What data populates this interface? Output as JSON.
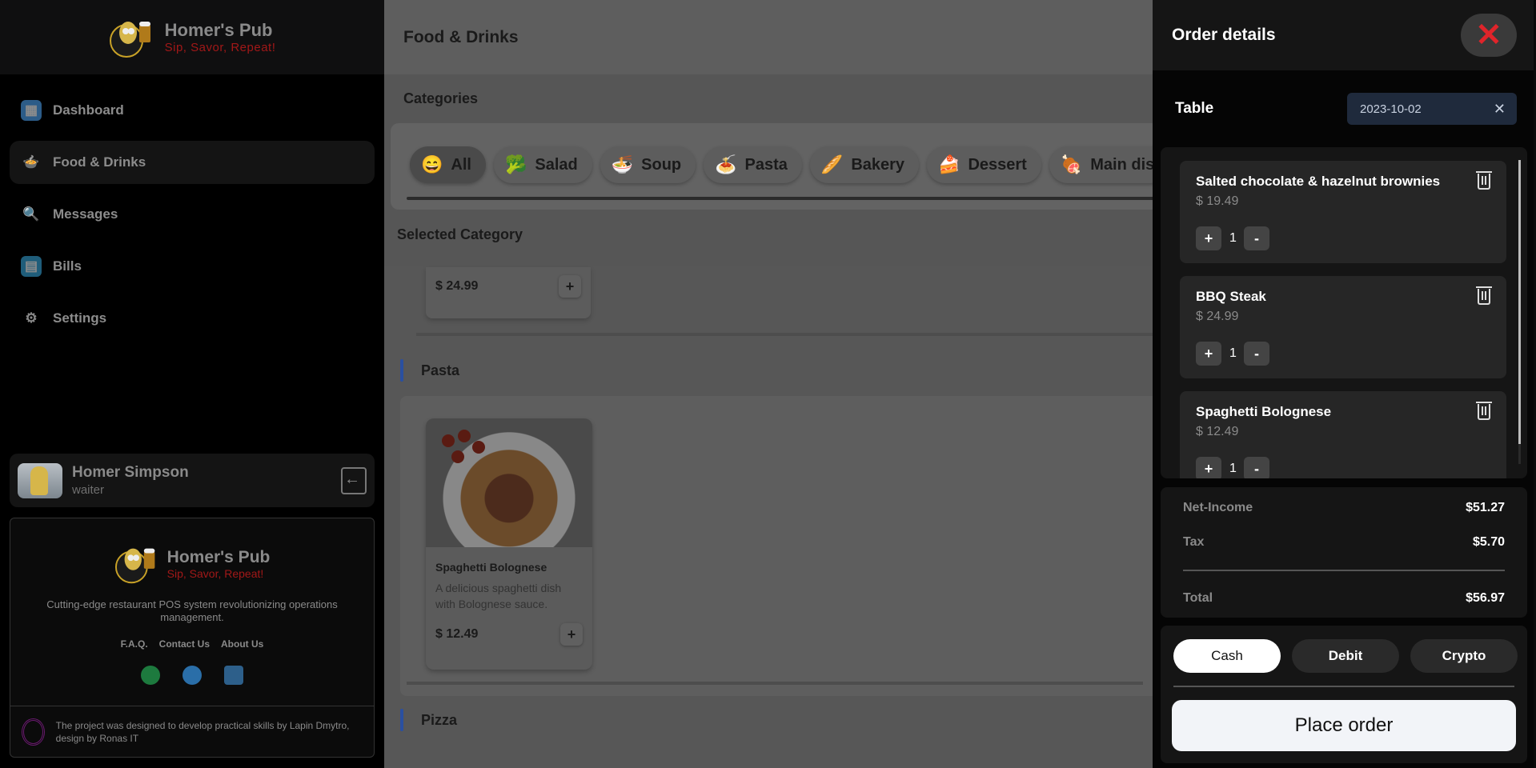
{
  "brand": {
    "name": "Homer's Pub",
    "tagline": "Sip, Savor, Repeat!"
  },
  "nav": [
    {
      "label": "Dashboard",
      "icon": "dashboard-icon",
      "active": false
    },
    {
      "label": "Food & Drinks",
      "icon": "food-icon",
      "active": true
    },
    {
      "label": "Messages",
      "icon": "messages-icon",
      "active": false
    },
    {
      "label": "Bills",
      "icon": "bills-icon",
      "active": false
    },
    {
      "label": "Settings",
      "icon": "gear-icon",
      "active": false
    }
  ],
  "user": {
    "name": "Homer Simpson",
    "role": "waiter"
  },
  "footer": {
    "description": "Cutting-edge restaurant POS system revolutionizing operations management.",
    "links": [
      "F.A.Q.",
      "Contact Us",
      "About Us"
    ],
    "credit": "The project was designed to develop practical skills by Lapin Dmytro, design by Ronas IT"
  },
  "main": {
    "title": "Food & Drinks",
    "categories_title": "Categories",
    "categories": [
      {
        "label": "All",
        "icon": "😄",
        "active": true
      },
      {
        "label": "Salad",
        "icon": "🥦",
        "active": false
      },
      {
        "label": "Soup",
        "icon": "🍜",
        "active": false
      },
      {
        "label": "Pasta",
        "icon": "🍝",
        "active": false
      },
      {
        "label": "Bakery",
        "icon": "🥖",
        "active": false
      },
      {
        "label": "Dessert",
        "icon": "🍰",
        "active": false
      },
      {
        "label": "Main dis",
        "icon": "🍖",
        "active": false
      }
    ],
    "selected_title": "Selected Category",
    "partial_card_price": "$ 24.99",
    "section_pasta": "Pasta",
    "section_pizza": "Pizza",
    "food": {
      "name": "Spaghetti Bolognese",
      "description": "A delicious spaghetti dish with Bolognese sauce.",
      "price": "$ 12.49"
    }
  },
  "order": {
    "title": "Order details",
    "table_label": "Table",
    "date": "2023-10-02",
    "items": [
      {
        "name": "Salted chocolate & hazelnut brownies",
        "price": "$ 19.49",
        "qty": "1"
      },
      {
        "name": "BBQ Steak",
        "price": "$ 24.99",
        "qty": "1"
      },
      {
        "name": "Spaghetti Bolognese",
        "price": "$ 12.49",
        "qty": "1"
      }
    ],
    "net_income_label": "Net-Income",
    "net_income": "$51.27",
    "tax_label": "Tax",
    "tax": "$5.70",
    "total_label": "Total",
    "total": "$56.97",
    "payment": [
      "Cash",
      "Debit",
      "Crypto"
    ],
    "payment_selected": "Cash",
    "place_order": "Place order"
  },
  "colors": {
    "accent_red": "#a11818",
    "close_red": "#e0242a",
    "pasta_bar": "#2a4fa0",
    "date_bg": "#1f2a3c"
  }
}
